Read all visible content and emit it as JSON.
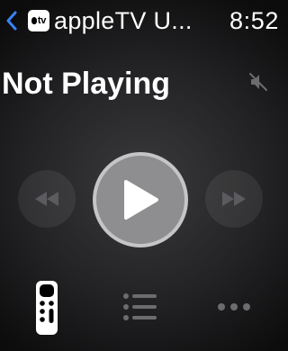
{
  "status_bar": {
    "back_icon": "chevron-left-icon",
    "app_badge_label": "tv",
    "app_title": "appleTV U...",
    "time": "8:52"
  },
  "now_playing": {
    "status_text": "Not Playing",
    "mute_icon": "speaker-muted-icon"
  },
  "playback_controls": {
    "rewind_icon": "rewind-icon",
    "play_icon": "play-icon",
    "fast_forward_icon": "fast-forward-icon"
  },
  "tab_bar": {
    "remote_icon": "remote-icon",
    "list_icon": "list-icon",
    "more_icon": "more-icon"
  },
  "colors": {
    "accent": "#3a82f7",
    "text": "#ffffff",
    "play_fill": "#8e8e91",
    "play_ring": "#c5c5c7",
    "dim_icon": "#5b5b5f"
  }
}
